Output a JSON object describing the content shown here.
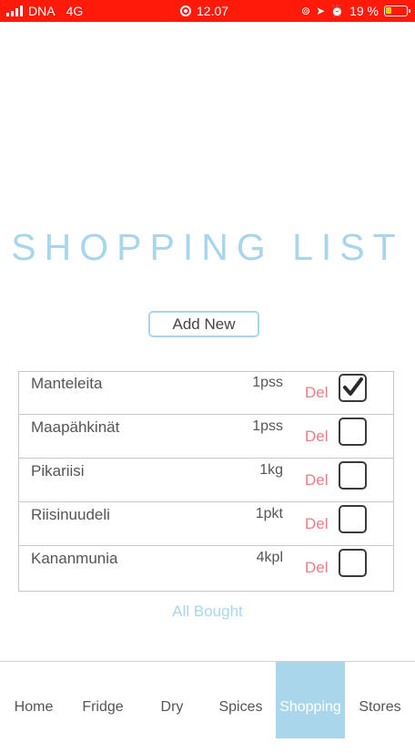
{
  "status_bar": {
    "carrier": "DNA",
    "network": "4G",
    "time": "12.07",
    "battery": "19 %"
  },
  "title": "SHOPPING LIST",
  "add_button": "Add New",
  "items": [
    {
      "name": "Manteleita",
      "qty": "1pss",
      "del": "Del",
      "checked": true
    },
    {
      "name": "Maapähkinät",
      "qty": "1pss",
      "del": "Del",
      "checked": false
    },
    {
      "name": "Pikariisi",
      "qty": "1kg",
      "del": "Del",
      "checked": false
    },
    {
      "name": "Riisinuudeli",
      "qty": "1pkt",
      "del": "Del",
      "checked": false
    },
    {
      "name": "Kananmunia",
      "qty": "4kpl",
      "del": "Del",
      "checked": false
    }
  ],
  "all_bought": "All Bought",
  "nav": [
    {
      "label": "Home",
      "active": false
    },
    {
      "label": "Fridge",
      "active": false
    },
    {
      "label": "Dry",
      "active": false
    },
    {
      "label": "Spices",
      "active": false
    },
    {
      "label": "Shopping",
      "active": true
    },
    {
      "label": "Stores",
      "active": false
    }
  ],
  "colors": {
    "status_bar": "#ff1a0a",
    "accent": "#a9d6ea",
    "delete": "#ea7d86"
  }
}
